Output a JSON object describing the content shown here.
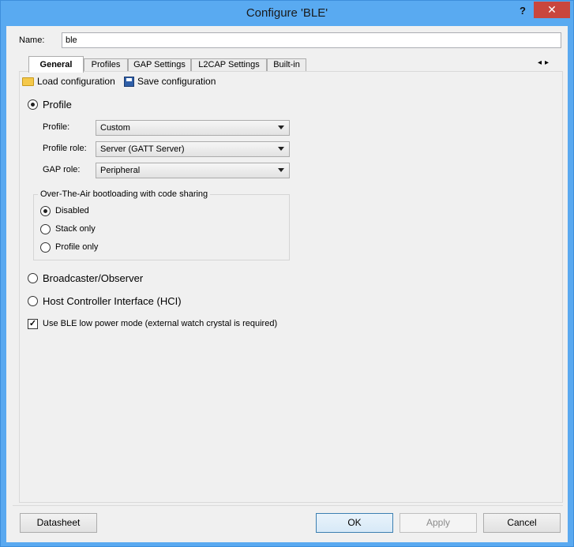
{
  "window": {
    "title": "Configure 'BLE'",
    "help_label": "?",
    "close_label": "✕"
  },
  "name_field": {
    "label": "Name:",
    "value": "ble"
  },
  "tabs": [
    {
      "label": "General",
      "active": true
    },
    {
      "label": "Profiles",
      "active": false
    },
    {
      "label": "GAP Settings",
      "active": false
    },
    {
      "label": "L2CAP Settings",
      "active": false
    },
    {
      "label": "Built-in",
      "active": false
    }
  ],
  "tab_scroll": {
    "left": "◂",
    "right": "▸"
  },
  "toolbar": {
    "load_label": "Load configuration",
    "save_label": "Save configuration",
    "load_icon": "folder-open-icon",
    "save_icon": "floppy-disk-icon"
  },
  "mode": {
    "profile_label": "Profile",
    "profile_selected": true,
    "broadcaster_label": "Broadcaster/Observer",
    "hci_label": "Host Controller Interface (HCI)"
  },
  "profile_settings": {
    "profile_label": "Profile:",
    "profile_value": "Custom",
    "role_label": "Profile role:",
    "role_value": "Server (GATT Server)",
    "gap_label": "GAP role:",
    "gap_value": "Peripheral"
  },
  "ota": {
    "title": "Over-The-Air bootloading with code sharing",
    "options": [
      {
        "label": "Disabled",
        "selected": true
      },
      {
        "label": "Stack only",
        "selected": false
      },
      {
        "label": "Profile only",
        "selected": false
      }
    ]
  },
  "low_power": {
    "label": "Use BLE low power mode (external watch crystal is required)",
    "checked": true,
    "mark": "✓"
  },
  "buttons": {
    "datasheet": "Datasheet",
    "ok": "OK",
    "apply": "Apply",
    "cancel": "Cancel"
  }
}
